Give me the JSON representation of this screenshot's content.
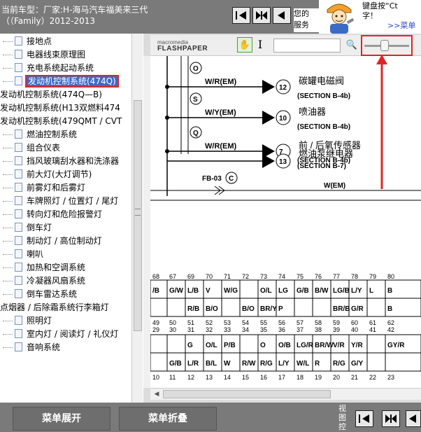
{
  "header": {
    "car_line1": "当前车型：厂家:H-海马汽车福美来三代",
    "car_line2": "（（Family）2012-2013",
    "notice_line1": "您的",
    "notice_line2": "服务",
    "tip_line1": "键盘按“Ct",
    "tip_line2": "字！",
    "tip_link": ">>菜单"
  },
  "sidebar": {
    "items": [
      {
        "label": "接地点",
        "level": 2
      },
      {
        "label": "电器线束原理图",
        "level": 2
      },
      {
        "label": "充电系统起动系统",
        "level": 2
      },
      {
        "label": "发动机控制系统(474Q)",
        "level": 2,
        "selected": true
      },
      {
        "label": "发动机控制系统(474Q—B)",
        "level": 0
      },
      {
        "label": "发动机控制系统(H13双燃料474",
        "level": 0
      },
      {
        "label": "发动机控制系统(479QMT / CVT",
        "level": 0
      },
      {
        "label": "燃油控制系统",
        "level": 2
      },
      {
        "label": "组合仪表",
        "level": 2
      },
      {
        "label": "挡风玻璃刮水器和洗涤器",
        "level": 2
      },
      {
        "label": "前大灯(大灯调节)",
        "level": 2
      },
      {
        "label": "前雾灯和后雾灯",
        "level": 2
      },
      {
        "label": "车牌照灯 / 位置灯 / 尾灯",
        "level": 2
      },
      {
        "label": "转向灯和危险报警灯",
        "level": 2
      },
      {
        "label": "倒车灯",
        "level": 2
      },
      {
        "label": "制动灯 / 高位制动灯",
        "level": 2
      },
      {
        "label": "喇叭",
        "level": 2
      },
      {
        "label": "加热和空调系统",
        "level": 2
      },
      {
        "label": "冷凝器风扇系统",
        "level": 2
      },
      {
        "label": "倒车雷达系统",
        "level": 2
      },
      {
        "label": "点烟器 / 后除霜系统行李箱灯",
        "level": 0
      },
      {
        "label": "照明灯",
        "level": 2
      },
      {
        "label": "室内灯 / 阅读灯 / 礼仪灯",
        "level": 2
      },
      {
        "label": "音响系统",
        "level": 2
      }
    ]
  },
  "viewer": {
    "logo_small": "macromedia",
    "logo_big": "FLASHPAPER",
    "search_value": "",
    "zoom_fraction": 0.45
  },
  "diagram": {
    "wires": [
      {
        "wire": "W/R(EM)",
        "pin": "12",
        "label_cn": "碳罐电磁阀",
        "section": "(SECTION B-4b)",
        "splice": "O"
      },
      {
        "wire": "W/Y(EM)",
        "pin": "10",
        "label_cn": "喷油器",
        "section": "(SECTION B-4b)",
        "splice": "S"
      },
      {
        "wire": "W/R(EM)",
        "pin": "7",
        "label_cn": "前 / 后氧传感器",
        "section": "(SECTION B-4b)",
        "splice": "Q"
      },
      {
        "wire": "",
        "pin": "13",
        "label_cn": "燃油泵继电器",
        "section": "(SECTION B-7)",
        "splice": ""
      }
    ],
    "fb_label": "FB-03",
    "fb_circle": "C",
    "bus_label": "W(EM)",
    "table1_numbers": [
      "68",
      "67",
      "69",
      "70",
      "71",
      "72",
      "73",
      "74",
      "75",
      "76",
      "77",
      "78",
      "79",
      "80"
    ],
    "table1_row1": [
      "/B",
      "G/W",
      "L/B",
      "V",
      "W/G",
      "",
      "O/L",
      "LG",
      "G/B",
      "B/W",
      "LG/B",
      "L/Y",
      "L",
      "B"
    ],
    "table1_row2": [
      "",
      "",
      "R/B",
      "B/O",
      "",
      "B/O",
      "BR/Y",
      "P",
      "",
      "",
      "BR/B",
      "G/R",
      "",
      "B"
    ],
    "table1_bottom": [
      "49",
      "50",
      "51",
      "52",
      "53",
      "54",
      "55",
      "56",
      "57",
      "58",
      "59",
      "60",
      "61",
      "62"
    ],
    "table2_top": [
      "29",
      "30",
      "31",
      "32",
      "33",
      "34",
      "35",
      "36",
      "37",
      "38",
      "39",
      "40",
      "41",
      "42"
    ],
    "table2_row1": [
      "",
      "",
      "G",
      "O/L",
      "P/B",
      "",
      "O",
      "O/B",
      "LG/R",
      "BR/W",
      "V/R",
      "Y/R",
      "",
      "GY/R"
    ],
    "table2_row2": [
      "",
      "G/B",
      "L/R",
      "B/L",
      "W",
      "R/W",
      "R/G",
      "L/Y",
      "W/L",
      "R",
      "R/G",
      "G/Y",
      "",
      ""
    ],
    "table2_bottom": [
      "10",
      "11",
      "12",
      "13",
      "14",
      "15",
      "16",
      "17",
      "18",
      "19",
      "20",
      "21",
      "22",
      "23"
    ]
  },
  "bottom": {
    "expand_label": "菜单展开",
    "collapse_label": "菜单折叠",
    "view_label": "视图控"
  }
}
